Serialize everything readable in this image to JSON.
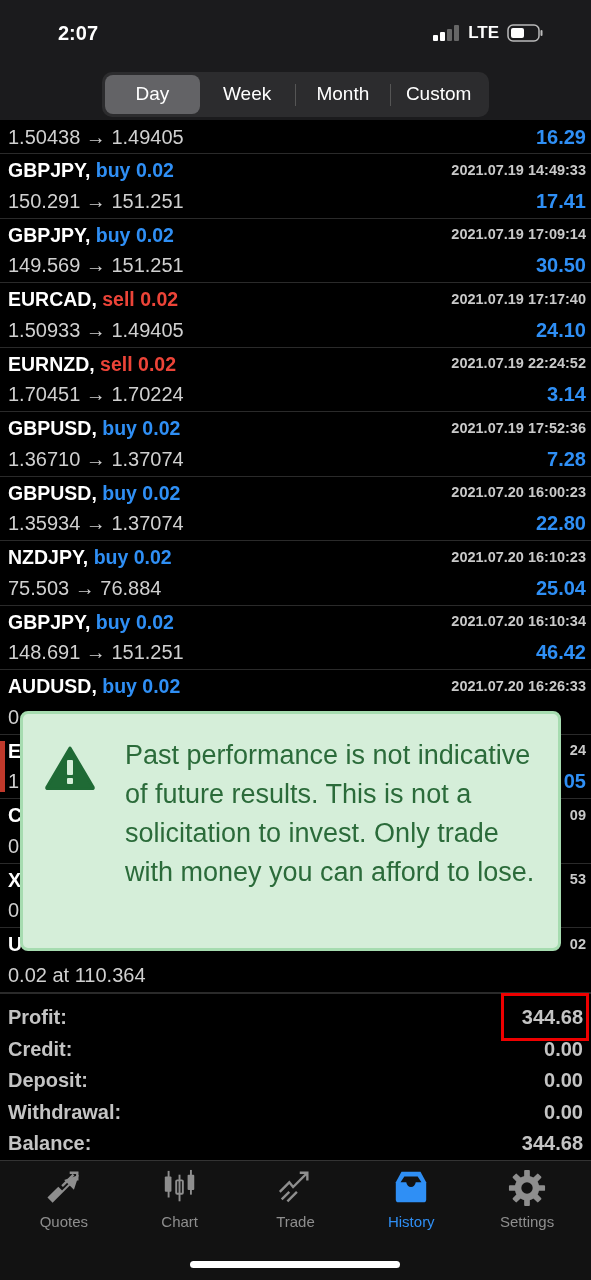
{
  "status_bar": {
    "time": "2:07",
    "network": "LTE"
  },
  "periods": [
    {
      "label": "Day",
      "selected": true
    },
    {
      "label": "Week",
      "selected": false
    },
    {
      "label": "Month",
      "selected": false
    },
    {
      "label": "Custom",
      "selected": false
    }
  ],
  "deals": [
    {
      "kind": "bottom",
      "price": "1.50438 → 1.49405",
      "profit": "16.29",
      "marked": false
    },
    {
      "kind": "full",
      "symbol": "GBPJPY,",
      "order": {
        "text": "buy 0.02",
        "kind": "buy"
      },
      "time": "2021.07.19 14:49:33",
      "price": "150.291 → 151.251",
      "profit": "17.41",
      "marked": false
    },
    {
      "kind": "full",
      "symbol": "GBPJPY,",
      "order": {
        "text": "buy 0.02",
        "kind": "buy"
      },
      "time": "2021.07.19 17:09:14",
      "price": "149.569 → 151.251",
      "profit": "30.50",
      "marked": false
    },
    {
      "kind": "full",
      "symbol": "EURCAD,",
      "order": {
        "text": "sell 0.02",
        "kind": "sell"
      },
      "time": "2021.07.19 17:17:40",
      "price": "1.50933 → 1.49405",
      "profit": "24.10",
      "marked": false
    },
    {
      "kind": "full",
      "symbol": "EURNZD,",
      "order": {
        "text": "sell 0.02",
        "kind": "sell"
      },
      "time": "2021.07.19 22:24:52",
      "price": "1.70451 → 1.70224",
      "profit": "3.14",
      "marked": false
    },
    {
      "kind": "full",
      "symbol": "GBPUSD,",
      "order": {
        "text": "buy 0.02",
        "kind": "buy"
      },
      "time": "2021.07.19 17:52:36",
      "price": "1.36710 → 1.37074",
      "profit": "7.28",
      "marked": false
    },
    {
      "kind": "full",
      "symbol": "GBPUSD,",
      "order": {
        "text": "buy 0.02",
        "kind": "buy"
      },
      "time": "2021.07.20 16:00:23",
      "price": "1.35934 → 1.37074",
      "profit": "22.80",
      "marked": false
    },
    {
      "kind": "full",
      "symbol": "NZDJPY,",
      "order": {
        "text": "buy 0.02",
        "kind": "buy"
      },
      "time": "2021.07.20 16:10:23",
      "price": "75.503 → 76.884",
      "profit": "25.04",
      "marked": false
    },
    {
      "kind": "full",
      "symbol": "GBPJPY,",
      "order": {
        "text": "buy 0.02",
        "kind": "buy"
      },
      "time": "2021.07.20 16:10:34",
      "price": "148.691 → 151.251",
      "profit": "46.42",
      "marked": false
    },
    {
      "kind": "full",
      "symbol": "AUDUSD,",
      "order": {
        "text": "buy 0.02",
        "kind": "buy"
      },
      "time": "2021.07.20 16:26:33",
      "price": "0",
      "marked": false
    },
    {
      "kind": "full",
      "symbol": "E",
      "time": "24",
      "price": "1",
      "profit": "05",
      "marked": true
    },
    {
      "kind": "full",
      "symbol": "C",
      "time": "09",
      "price": "0",
      "marked": false
    },
    {
      "kind": "full",
      "symbol": "X",
      "time": "53",
      "price": "0",
      "marked": false
    },
    {
      "kind": "full",
      "symbol": "U",
      "time": "02",
      "price": "0.02 at 110.364",
      "marked": false
    }
  ],
  "notice": {
    "text": "Past performance is not indicative of future results. This is not a solicitation to invest. Only trade with money you can afford to lose."
  },
  "summary": [
    {
      "label": "Profit:",
      "value": "344.68",
      "highlighted": true
    },
    {
      "label": "Credit:",
      "value": "0.00",
      "highlighted": false
    },
    {
      "label": "Deposit:",
      "value": "0.00",
      "highlighted": false
    },
    {
      "label": "Withdrawal:",
      "value": "0.00",
      "highlighted": false
    },
    {
      "label": "Balance:",
      "value": "344.68",
      "highlighted": false
    }
  ],
  "tabs": [
    {
      "label": "Quotes",
      "kind": "quotes",
      "selected": false
    },
    {
      "label": "Chart",
      "kind": "chart",
      "selected": false
    },
    {
      "label": "Trade",
      "kind": "trade",
      "selected": false
    },
    {
      "label": "History",
      "kind": "history",
      "selected": true
    },
    {
      "label": "Settings",
      "kind": "settings",
      "selected": false
    }
  ]
}
